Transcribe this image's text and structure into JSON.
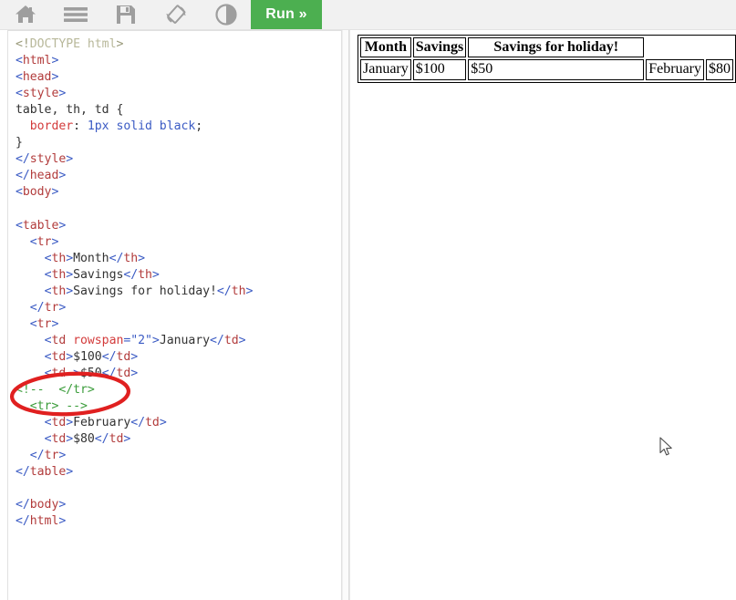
{
  "toolbar": {
    "icons": [
      {
        "name": "home-icon",
        "label": "Home"
      },
      {
        "name": "menu-icon",
        "label": "Menu"
      },
      {
        "name": "save-icon",
        "label": "Save"
      },
      {
        "name": "rotate-layout-icon",
        "label": "Change Orientation"
      },
      {
        "name": "contrast-icon",
        "label": "Dark Mode"
      }
    ],
    "run_label": "Run »"
  },
  "editor": {
    "lines": [
      "<!DOCTYPE html>",
      "<html>",
      "<head>",
      "<style>",
      "table, th, td {",
      "  border: 1px solid black;",
      "}",
      "</style>",
      "</head>",
      "<body>",
      "",
      "<table>",
      "  <tr>",
      "    <th>Month</th>",
      "    <th>Savings</th>",
      "    <th>Savings for holiday!</th>",
      "  </tr>",
      "  <tr>",
      "    <td rowspan=\"2\">January</td>",
      "    <td>$100</td>",
      "    <td >$50</td>",
      "<!--  </tr>",
      "  <tr> -->",
      "    <td>February</td>",
      "    <td>$80</td>",
      "  </tr>",
      "</table>",
      "",
      "</body>",
      "</html>"
    ],
    "colors": {
      "tag": "#3b5bc4",
      "tag_name": "#b23c3c",
      "attribute": "#d33b3b",
      "value": "#3b5bc4",
      "comment": "#3a9c3a",
      "text": "#333333"
    }
  },
  "output": {
    "table": {
      "headers": [
        "Month",
        "Savings",
        "Savings for holiday!"
      ],
      "rows": [
        [
          "January",
          "$100",
          "$50",
          "February",
          "$80"
        ]
      ]
    }
  },
  "annotation": {
    "shape": "ellipse",
    "color": "#e02020",
    "target_text": "<!--  </tr>\n  <tr> -->"
  }
}
